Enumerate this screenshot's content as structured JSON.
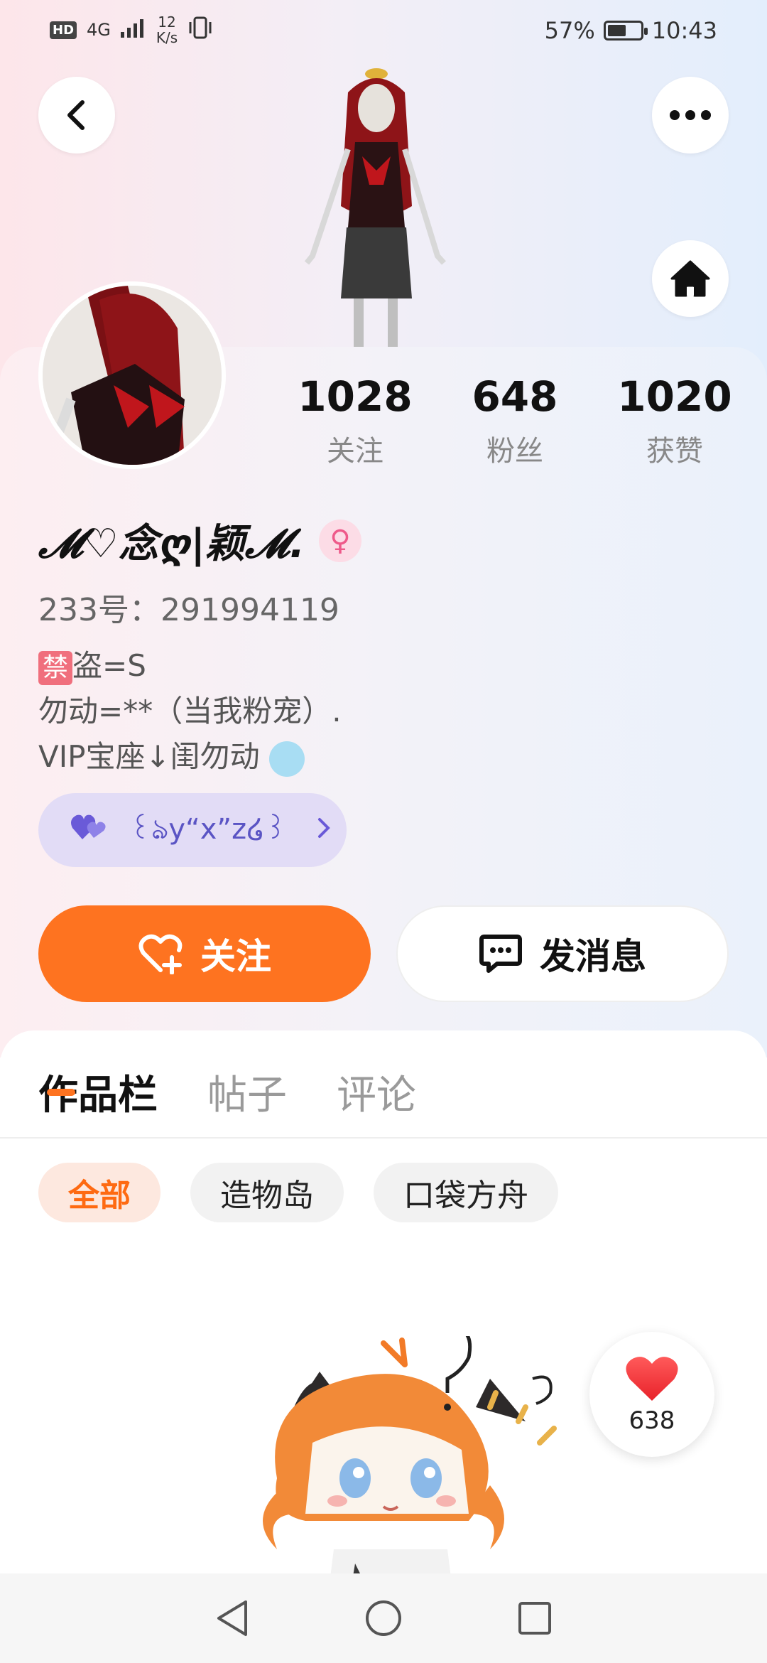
{
  "status_bar": {
    "network_hd": "HD",
    "network_type": "4G",
    "speed_value": "12",
    "speed_unit": "K/s",
    "battery": "57%",
    "battery_level": 0.57,
    "time": "10:43"
  },
  "profile": {
    "username": "𝓜♡念ღ|颖𝓜.",
    "gender_symbol": "♀",
    "uid": "233号：291994119",
    "bio_tag": "禁",
    "bio_line1": "盗=S",
    "bio_line2": "勿动=**（当我粉宠）.",
    "bio_line3": "VIP宝座↓闺勿动",
    "pill_text": "꒰ঌy“x”z໒꒱",
    "stats": [
      {
        "value": "1028",
        "label": "关注"
      },
      {
        "value": "648",
        "label": "粉丝"
      },
      {
        "value": "1020",
        "label": "获赞"
      }
    ]
  },
  "actions": {
    "follow_label": "关注",
    "message_label": "发消息"
  },
  "tabs": [
    "作品栏",
    "帖子",
    "评论"
  ],
  "chips": [
    "全部",
    "造物岛",
    "口袋方舟"
  ],
  "like_count": "638",
  "colors": {
    "accent": "#fe7320",
    "pill_bg": "#e2dcf6",
    "gender_pink": "#ee5a8a"
  },
  "icons": {
    "back": "chevron-left-icon",
    "more": "more-dots-icon",
    "home": "home-icon",
    "follow": "heart-plus-icon",
    "message": "chat-bubble-icon",
    "like": "heart-icon"
  }
}
